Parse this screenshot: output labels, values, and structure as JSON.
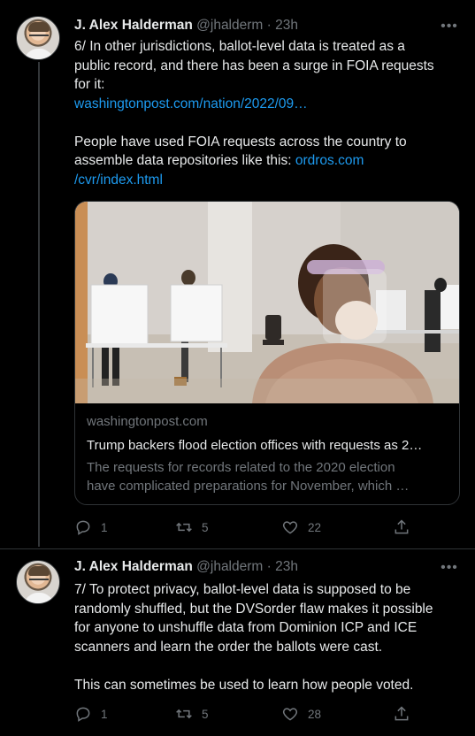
{
  "tweets": [
    {
      "name": "J. Alex Halderman",
      "handle": "@jhalderm",
      "dot": "·",
      "time": "23h",
      "text_line1": "6/ In other jurisdictions, ballot-level data is treated as a",
      "text_line2": "public record, and there has been a surge in FOIA requests",
      "text_line3": "for it:",
      "link1": "washingtonpost.com/nation/2022/09…",
      "text_line5": "People have used FOIA requests across the country to",
      "text_line6_prefix": "assemble data repositories like this: ",
      "link2_part1": "ordros.com",
      "link2_part2": "/cvr/index.html",
      "card": {
        "domain": "washingtonpost.com",
        "title": "Trump backers flood election offices with requests as 2…",
        "desc_line1": "The requests for records related to the 2020 election",
        "desc_line2": "have complicated preparations for November, which …"
      },
      "replies": "1",
      "retweets": "5",
      "likes": "22"
    },
    {
      "name": "J. Alex Halderman",
      "handle": "@jhalderm",
      "dot": "·",
      "time": "23h",
      "text_line1": "7/ To protect privacy, ballot-level data is supposed to be",
      "text_line2": "randomly shuffled, but the DVSorder flaw makes it possible",
      "text_line3": "for anyone to unshuffle data from Dominion ICP and ICE",
      "text_line4": "scanners and learn the order the ballots were cast.",
      "text_line6": "This can sometimes be used to learn how people voted.",
      "replies": "1",
      "retweets": "5",
      "likes": "28"
    }
  ],
  "colors": {
    "background": "#000000",
    "link": "#1d9bf0",
    "muted": "#71767b",
    "text": "#e7e9ea"
  },
  "icons": [
    "more-icon",
    "reply-icon",
    "retweet-icon",
    "like-icon",
    "share-icon"
  ]
}
